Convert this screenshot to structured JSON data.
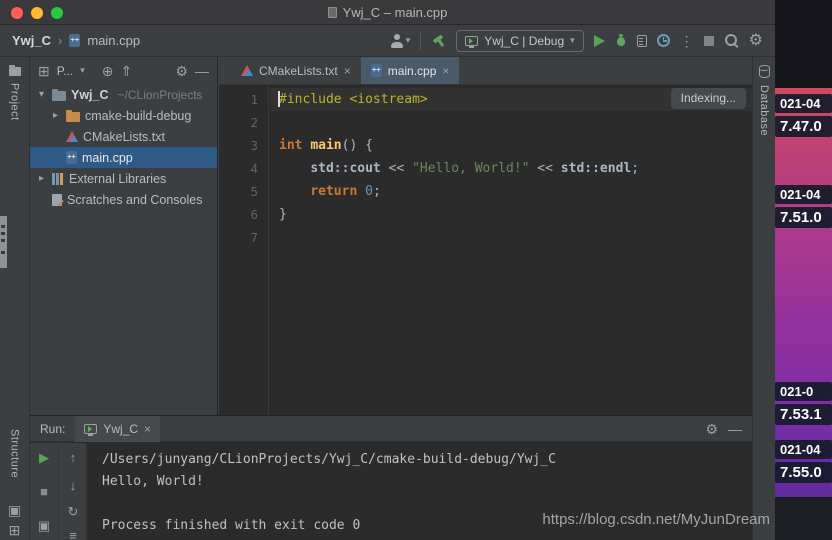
{
  "window": {
    "title": "Ywj_C – main.cpp"
  },
  "navbar": {
    "project": "Ywj_C",
    "separator": "›",
    "file": "main.cpp",
    "run_config": "Ywj_C | Debug"
  },
  "stripes": {
    "project": "Project",
    "structure": "Structure",
    "database": "Database"
  },
  "project_panel": {
    "header_label": "P...",
    "tree": [
      {
        "label": "Ywj_C",
        "hint": "~/CLionProjects",
        "icon": "folder",
        "chevron": "down",
        "indent": 0,
        "bold": true,
        "selected": false
      },
      {
        "label": "cmake-build-debug",
        "icon": "folder-excluded",
        "chevron": "right",
        "indent": 1,
        "selected": false
      },
      {
        "label": "CMakeLists.txt",
        "icon": "cmake",
        "chevron": null,
        "indent": 1,
        "selected": false
      },
      {
        "label": "main.cpp",
        "icon": "cpp",
        "chevron": null,
        "indent": 1,
        "selected": true
      },
      {
        "label": "External Libraries",
        "icon": "library",
        "chevron": "right",
        "indent": 0,
        "selected": false
      },
      {
        "label": "Scratches and Consoles",
        "icon": "scratches",
        "chevron": null,
        "indent": 0,
        "selected": false
      }
    ]
  },
  "editor": {
    "tabs": [
      {
        "label": "CMakeLists.txt",
        "icon": "cmake",
        "active": false
      },
      {
        "label": "main.cpp",
        "icon": "cpp",
        "active": true
      }
    ],
    "indexing_label": "Indexing...",
    "code_lines": [
      {
        "n": 1,
        "current": true,
        "tokens": [
          {
            "t": "#include ",
            "s": "pre"
          },
          {
            "t": "<iostream>",
            "s": "pre"
          }
        ]
      },
      {
        "n": 2,
        "current": false,
        "tokens": []
      },
      {
        "n": 3,
        "current": false,
        "tokens": [
          {
            "t": "int ",
            "s": "kw"
          },
          {
            "t": "main",
            "s": "fn"
          },
          {
            "t": "() {",
            "s": "pln"
          }
        ]
      },
      {
        "n": 4,
        "current": false,
        "tokens": [
          {
            "t": "    ",
            "s": "pln"
          },
          {
            "t": "std::cout",
            "s": "b"
          },
          {
            "t": " << ",
            "s": "pln"
          },
          {
            "t": "\"Hello, World!\"",
            "s": "str"
          },
          {
            "t": " << ",
            "s": "pln"
          },
          {
            "t": "std::endl",
            "s": "b"
          },
          {
            "t": ";",
            "s": "pln"
          }
        ]
      },
      {
        "n": 5,
        "current": false,
        "tokens": [
          {
            "t": "    ",
            "s": "pln"
          },
          {
            "t": "return ",
            "s": "kw"
          },
          {
            "t": "0",
            "s": "num"
          },
          {
            "t": ";",
            "s": "pln"
          }
        ]
      },
      {
        "n": 6,
        "current": false,
        "tokens": [
          {
            "t": "}",
            "s": "pln"
          }
        ]
      },
      {
        "n": 7,
        "current": false,
        "tokens": []
      }
    ]
  },
  "run_panel": {
    "label": "Run:",
    "tab_label": "Ywj_C",
    "console_lines": [
      "/Users/junyang/CLionProjects/Ywj_C/cmake-build-debug/Ywj_C",
      "Hello, World!",
      "",
      "Process finished with exit code 0"
    ]
  },
  "desktop": {
    "blocks": [
      {
        "line1": "021-04",
        "line2": "7.47.0"
      },
      {
        "line1": "021-04",
        "line2": "7.51.0"
      },
      {
        "line1": "021-0",
        "line2": "7.53.1"
      },
      {
        "line1": "021-04",
        "line2": "7.55.0"
      }
    ]
  },
  "watermark": "https://blog.csdn.net/MyJunDream",
  "icons": {
    "chevron-down": "▾",
    "chevron-right": "▸",
    "close": "×",
    "gear": "⚙",
    "minimize": "—",
    "play": "▶",
    "stop": "■",
    "up": "↑",
    "down": "↓",
    "rerun": "↻",
    "menu": "≡",
    "locate": "⊕",
    "collapse": "⇑",
    "more": "⋮",
    "grid": "⊞",
    "console": "▣",
    "caret-down": "▾"
  }
}
